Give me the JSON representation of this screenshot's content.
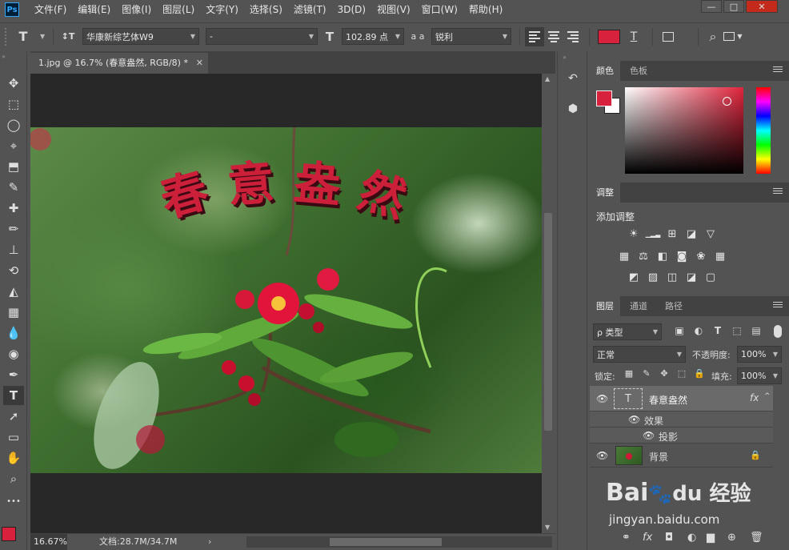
{
  "app": {
    "logo": "Ps"
  },
  "menubar": {
    "items": [
      "文件(F)",
      "编辑(E)",
      "图像(I)",
      "图层(L)",
      "文字(Y)",
      "选择(S)",
      "滤镜(T)",
      "3D(D)",
      "视图(V)",
      "窗口(W)",
      "帮助(H)"
    ]
  },
  "window_controls": {
    "minimize": "—",
    "maximize": "□",
    "close": "✕"
  },
  "options": {
    "tool_glyph": "T",
    "orient_glyph": "↕T",
    "font_family": "华康新综艺体W9",
    "font_style": "-",
    "size_glyph": "T",
    "font_size": "102.89 点",
    "aa_glyph": "a a",
    "anti_alias": "锐利",
    "color": "#d7213d",
    "warp_glyph": "T",
    "search_glyph": "⌕"
  },
  "document": {
    "tab_title": "1.jpg @ 16.7% (春意盎然, RGB/8) *",
    "close": "✕",
    "text_layer": "春意盎然",
    "text_color": "#cc1f3a"
  },
  "status": {
    "zoom": "16.67%",
    "doc_size": "文档:28.7M/34.7M",
    "arrow": "›"
  },
  "tools": [
    "✥",
    "⬚",
    "◯",
    "⌖",
    "⬒",
    "✎",
    "✚",
    "✏",
    "⊥",
    "⟲",
    "◭",
    "▦",
    "💧",
    "◉",
    "✒",
    "T",
    "➚",
    "▭",
    "✋",
    "⌕",
    "•••"
  ],
  "colors": {
    "foreground": "#d7213d",
    "background": "#ffffff",
    "panel": "#535353",
    "dark": "#424242"
  },
  "color_panel": {
    "tabs": [
      "颜色",
      "色板"
    ],
    "fg": "#d7213d",
    "bg": "#ffffff"
  },
  "adjust_panel": {
    "tab": "调整",
    "title": "添加调整",
    "row1": [
      "☀",
      "▁▂▃",
      "⊞",
      "◪",
      "▽"
    ],
    "row2": [
      "▦",
      "⚖",
      "◧",
      "◙",
      "❀",
      "▦"
    ],
    "row3": [
      "◩",
      "▨",
      "◫",
      "◪",
      "▢"
    ]
  },
  "layers_panel": {
    "tabs": [
      "图层",
      "通道",
      "路径"
    ],
    "filter": "ρ 类型",
    "blend_mode": "正常",
    "opacity_label": "不透明度:",
    "opacity": "100%",
    "lock_label": "锁定:",
    "fill_label": "填充:",
    "fill": "100%",
    "layers": [
      {
        "name": "春意盎然",
        "thumb": "T",
        "fx": "fx"
      },
      {
        "name": "效果"
      },
      {
        "name": "投影"
      },
      {
        "name": "背景",
        "lock": "🔒"
      }
    ],
    "bottom_icons": [
      "⚭",
      "fx",
      "◘",
      "◐",
      "▆",
      "⊕",
      "🗑"
    ]
  },
  "watermark": {
    "logo": "Bai",
    "paw": "🐾",
    "suffix": "du 经验",
    "url": "jingyan.baidu.com"
  }
}
